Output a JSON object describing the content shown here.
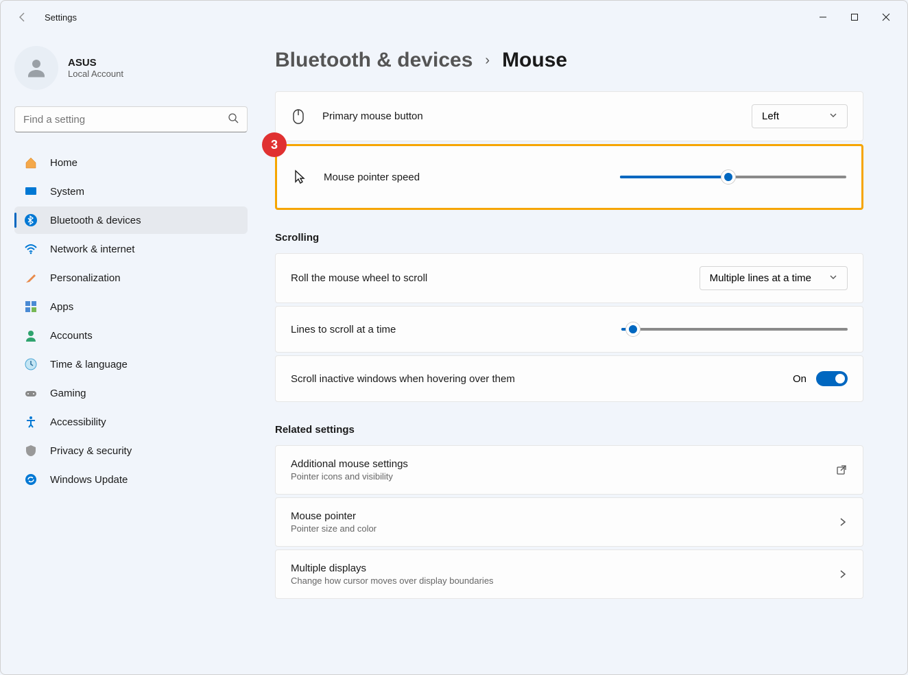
{
  "window": {
    "title": "Settings"
  },
  "profile": {
    "name": "ASUS",
    "subtitle": "Local Account"
  },
  "search": {
    "placeholder": "Find a setting"
  },
  "nav": [
    {
      "id": "home",
      "label": "Home"
    },
    {
      "id": "system",
      "label": "System"
    },
    {
      "id": "bluetooth",
      "label": "Bluetooth & devices",
      "active": true
    },
    {
      "id": "network",
      "label": "Network & internet"
    },
    {
      "id": "personalization",
      "label": "Personalization"
    },
    {
      "id": "apps",
      "label": "Apps"
    },
    {
      "id": "accounts",
      "label": "Accounts"
    },
    {
      "id": "time",
      "label": "Time & language"
    },
    {
      "id": "gaming",
      "label": "Gaming"
    },
    {
      "id": "accessibility",
      "label": "Accessibility"
    },
    {
      "id": "privacy",
      "label": "Privacy & security"
    },
    {
      "id": "update",
      "label": "Windows Update"
    }
  ],
  "breadcrumb": {
    "parent": "Bluetooth & devices",
    "current": "Mouse"
  },
  "settings": {
    "primary_button": {
      "label": "Primary mouse button",
      "value": "Left"
    },
    "pointer_speed": {
      "label": "Mouse pointer speed",
      "value_pct": 48
    },
    "scroll_section": "Scrolling",
    "scroll_mode": {
      "label": "Roll the mouse wheel to scroll",
      "value": "Multiple lines at a time"
    },
    "scroll_lines": {
      "label": "Lines to scroll at a time",
      "value_pct": 5
    },
    "inactive_scroll": {
      "label": "Scroll inactive windows when hovering over them",
      "value_label": "On"
    },
    "related_section": "Related settings",
    "additional": {
      "title": "Additional mouse settings",
      "subtitle": "Pointer icons and visibility"
    },
    "pointer": {
      "title": "Mouse pointer",
      "subtitle": "Pointer size and color"
    },
    "displays": {
      "title": "Multiple displays",
      "subtitle": "Change how cursor moves over display boundaries"
    }
  },
  "annotation": {
    "badge": "3"
  }
}
